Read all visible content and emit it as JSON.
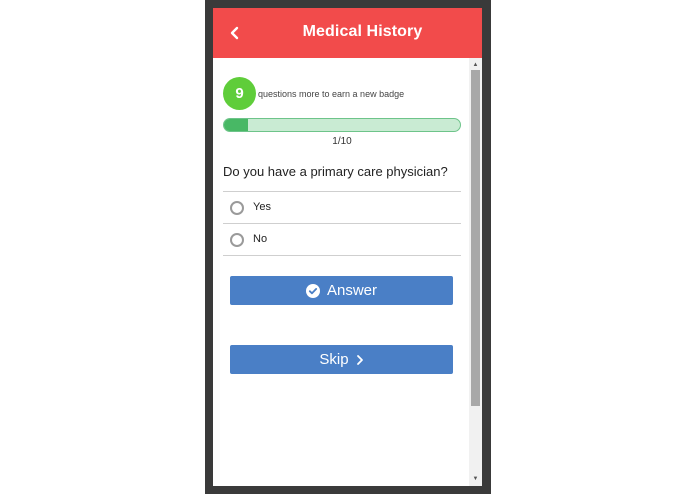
{
  "header": {
    "title": "Medical History",
    "back_icon": "chevron-left-icon",
    "background": "#f24b4b"
  },
  "badge": {
    "count": "9",
    "text": "questions more to earn a new badge",
    "color": "#5fcd3a"
  },
  "progress": {
    "label": "1/10",
    "fraction": 0.1
  },
  "question": {
    "text": "Do you have a primary care physician?",
    "options": [
      "Yes",
      "No"
    ],
    "selected": null
  },
  "buttons": {
    "answer": {
      "label": "Answer",
      "icon": "check-circle-icon"
    },
    "skip": {
      "label": "Skip",
      "icon": "chevron-right-icon"
    },
    "color": "#4a7fc6"
  },
  "scrollbar": {
    "up_icon": "▲",
    "down_icon": "▼"
  }
}
